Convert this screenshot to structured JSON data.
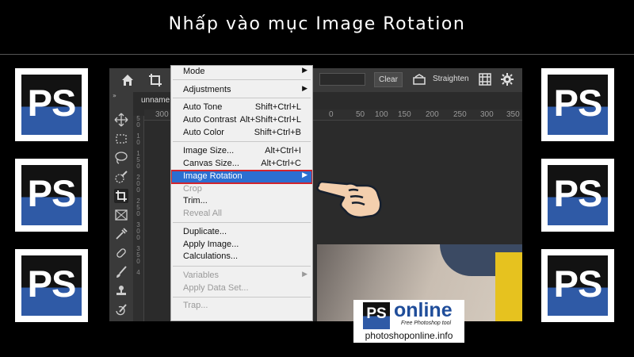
{
  "title": "Nhấp vào mục Image Rotation",
  "logo_tile_text": "PS",
  "toolbar": {
    "clear_label": "Clear",
    "straighten_label": "Straighten",
    "doc_tab_label": "unname"
  },
  "ruler": {
    "horizontal_ticks": [
      "300",
      "0",
      "50",
      "100",
      "150",
      "200",
      "250",
      "300",
      "350"
    ],
    "vertical_ticks": [
      "5",
      "0",
      "1",
      "0",
      "1",
      "5",
      "0",
      "2",
      "0",
      "0",
      "2",
      "5",
      "0",
      "3",
      "0",
      "0",
      "3",
      "5",
      "0",
      "4"
    ]
  },
  "menu": {
    "items": [
      {
        "label": "Mode",
        "shortcut": "",
        "submenu": true,
        "disabled": false
      },
      {
        "label": "Adjustments",
        "shortcut": "",
        "submenu": true,
        "disabled": false
      },
      {
        "label": "Auto Tone",
        "shortcut": "Shift+Ctrl+L",
        "submenu": false,
        "disabled": false
      },
      {
        "label": "Auto Contrast",
        "shortcut": "Alt+Shift+Ctrl+L",
        "submenu": false,
        "disabled": false
      },
      {
        "label": "Auto Color",
        "shortcut": "Shift+Ctrl+B",
        "submenu": false,
        "disabled": false
      },
      {
        "label": "Image Size...",
        "shortcut": "Alt+Ctrl+I",
        "submenu": false,
        "disabled": false
      },
      {
        "label": "Canvas Size...",
        "shortcut": "Alt+Ctrl+C",
        "submenu": false,
        "disabled": false
      },
      {
        "label": "Image Rotation",
        "shortcut": "",
        "submenu": true,
        "disabled": false,
        "highlighted": true
      },
      {
        "label": "Crop",
        "shortcut": "",
        "submenu": false,
        "disabled": true
      },
      {
        "label": "Trim...",
        "shortcut": "",
        "submenu": false,
        "disabled": false
      },
      {
        "label": "Reveal All",
        "shortcut": "",
        "submenu": false,
        "disabled": true
      },
      {
        "label": "Duplicate...",
        "shortcut": "",
        "submenu": false,
        "disabled": false
      },
      {
        "label": "Apply Image...",
        "shortcut": "",
        "submenu": false,
        "disabled": false
      },
      {
        "label": "Calculations...",
        "shortcut": "",
        "submenu": false,
        "disabled": false
      },
      {
        "label": "Variables",
        "shortcut": "",
        "submenu": true,
        "disabled": true
      },
      {
        "label": "Apply Data Set...",
        "shortcut": "",
        "submenu": false,
        "disabled": true
      },
      {
        "label": "Trap...",
        "shortcut": "",
        "submenu": false,
        "disabled": true
      }
    ]
  },
  "watermark": {
    "ps": "PS",
    "online": "online",
    "tagline": "Free Photoshop tool",
    "url": "photoshoponline.info"
  },
  "colors": {
    "highlight": "#2b6fd1",
    "highlight_border": "#d2242c",
    "ps_blue": "#2f5aa6",
    "brand_online": "#1f4d9a"
  }
}
